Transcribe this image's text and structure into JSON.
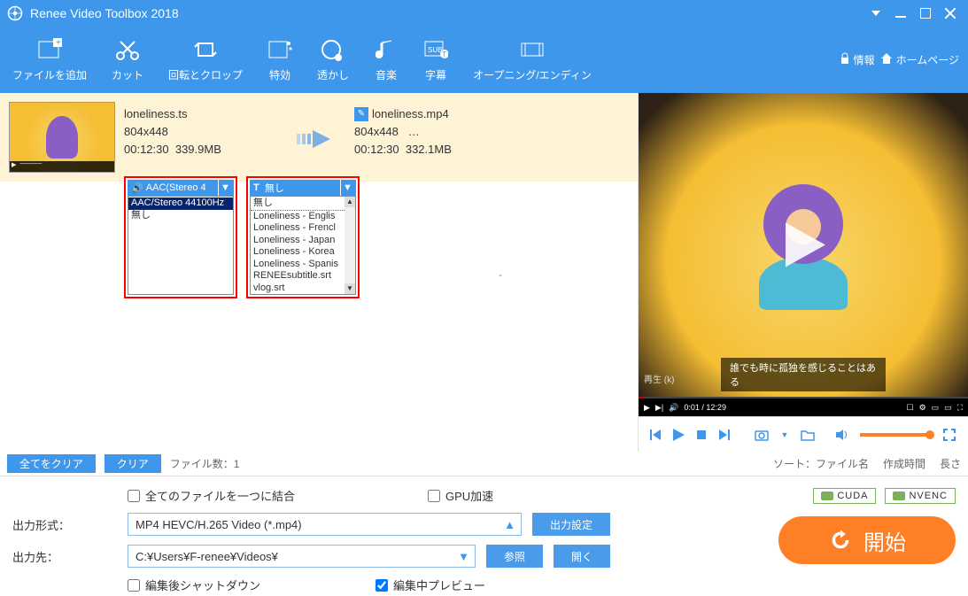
{
  "app": {
    "title": "Renee Video Toolbox 2018"
  },
  "titlebar_links": {
    "info": "情報",
    "home": "ホームページ"
  },
  "toolbar": [
    {
      "id": "add-file",
      "label": "ファイルを追加"
    },
    {
      "id": "cut",
      "label": "カット"
    },
    {
      "id": "rotate-crop",
      "label": "回転とクロップ"
    },
    {
      "id": "effects",
      "label": "特効"
    },
    {
      "id": "watermark",
      "label": "透かし"
    },
    {
      "id": "music",
      "label": "音楽"
    },
    {
      "id": "subtitle",
      "label": "字幕"
    },
    {
      "id": "opening-ending",
      "label": "オープニング/エンディン"
    }
  ],
  "file": {
    "src": {
      "name": "loneliness.ts",
      "resolution": "804x448",
      "duration": "00:12:30",
      "size": "339.9MB"
    },
    "dst": {
      "name": "loneliness.mp4",
      "resolution": "804x448",
      "extra": "…",
      "duration": "00:12:30",
      "size": "332.1MB"
    }
  },
  "audio_dropdown": {
    "header": "AAC(Stereo 4",
    "options": [
      "AAC/Stereo 44100Hz",
      "無し"
    ]
  },
  "subtitle_dropdown": {
    "header": "無し",
    "options": [
      "無し",
      "Loneliness - Englis",
      "Loneliness - Frencl",
      "Loneliness - Japan",
      "Loneliness - Korea",
      "Loneliness - Spanis",
      "RENEEsubtitle.srt",
      "vlog.srt"
    ]
  },
  "blank_row": "-",
  "footer": {
    "clear_all": "全てをクリア",
    "clear": "クリア",
    "file_count_label": "ファイル数：",
    "file_count": "1",
    "sort_label": "ソート：",
    "sort_options": [
      "ファイル名",
      "作成時間",
      "長さ"
    ]
  },
  "settings": {
    "merge_label": "全てのファイルを一つに結合",
    "gpu_label": "GPU加速",
    "cuda": "CUDA",
    "nvenc": "NVENC",
    "output_format_label": "出力形式：",
    "output_format_value": "MP4 HEVC/H.265 Video (*.mp4)",
    "output_settings_btn": "出力設定",
    "output_dest_label": "出力先：",
    "output_dest_value": "C:¥Users¥F-renee¥Videos¥",
    "browse_btn": "参照",
    "open_btn": "開く",
    "shutdown_label": "編集後シャットダウン",
    "preview_label": "編集中プレビュー",
    "start_btn": "開始"
  },
  "preview": {
    "subtitle_text": "誰でも時に孤独を感じることはある",
    "label": "再生 (k)",
    "time": "0:01 / 12:29"
  }
}
